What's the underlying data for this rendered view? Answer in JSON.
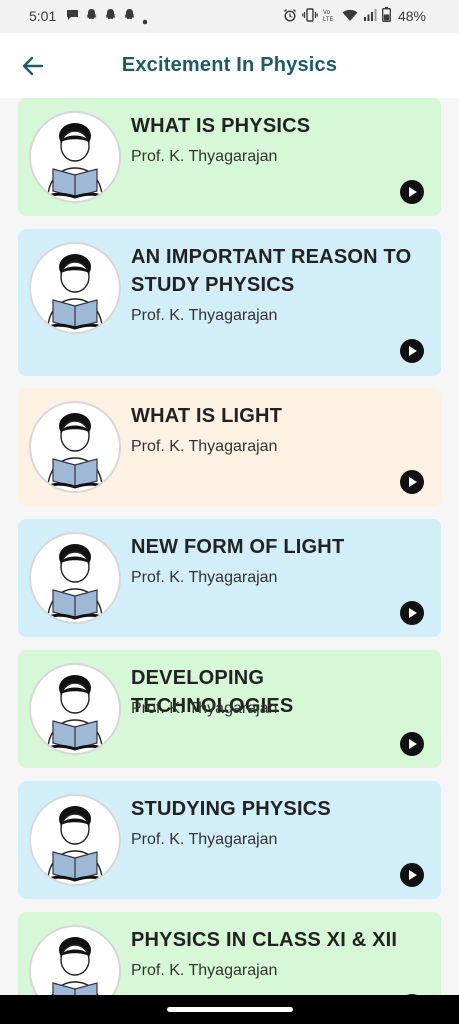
{
  "status_bar": {
    "time": "5:01",
    "battery": "48%",
    "notification_icons": [
      "chat-icon",
      "snapchat-icon",
      "snapchat-icon",
      "snapchat-icon",
      "dot-icon"
    ],
    "system_icons": [
      "alarm-icon",
      "vibrate-icon",
      "volte-icon",
      "wifi-icon",
      "signal-icon",
      "battery-icon"
    ]
  },
  "app_bar": {
    "title": "Excitement In Physics",
    "back_icon": "arrow-left-icon"
  },
  "colors": {
    "green_card": "#d6f8d6",
    "blue_card": "#d2eef9",
    "peach_card": "#fdf1e4",
    "title_color": "#1f5a6a"
  },
  "lectures": [
    {
      "title": "WHAT IS PHYSICS",
      "author": "Prof. K. Thyagarajan",
      "color": "#d6f8d6"
    },
    {
      "title": "AN IMPORTANT REASON TO STUDY PHYSICS",
      "author": "Prof. K. Thyagarajan",
      "color": "#d2eef9"
    },
    {
      "title": "WHAT IS LIGHT",
      "author": "Prof. K. Thyagarajan",
      "color": "#fdf1e4"
    },
    {
      "title": "NEW FORM OF LIGHT",
      "author": "Prof. K. Thyagarajan",
      "color": "#d2eef9"
    },
    {
      "title": "DEVELOPING TECHNOLOGIES",
      "author": "Prof. K. Thyagarajan",
      "color": "#d6f8d6"
    },
    {
      "title": "STUDYING PHYSICS",
      "author": "Prof. K. Thyagarajan",
      "color": "#d2eef9"
    },
    {
      "title": "PHYSICS IN CLASS XI & XII",
      "author": "Prof. K. Thyagarajan",
      "color": "#d6f8d6"
    }
  ]
}
